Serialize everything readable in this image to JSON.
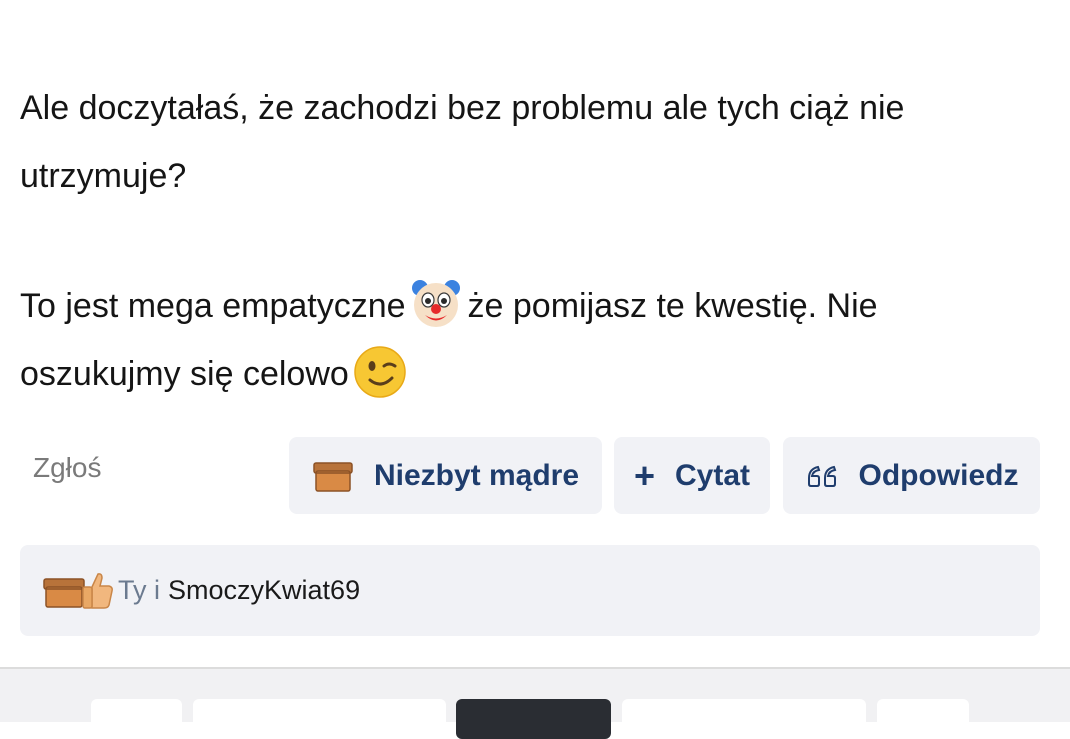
{
  "post": {
    "line1": "Ale doczytałaś, że zachodzi bez problemu ale tych ciąż nie",
    "line2": "utrzymuje?",
    "line3a": "To jest mega empatyczne",
    "line3b": "że pomijasz te kwestię. Nie",
    "line4": "oszukujmy się celowo",
    "emoji1": "clown-face",
    "emoji2": "winking-face"
  },
  "actions": {
    "report_label": "Zgłoś",
    "not_wise_label": "Niezbyt mądre",
    "quote_label": "Cytat",
    "reply_label": "Odpowiedz"
  },
  "reactions": {
    "you_label": "Ty i",
    "user_label": "SmoczyKwiat69",
    "icons": [
      "box-icon",
      "thumbs-up-icon"
    ]
  },
  "colors": {
    "accent": "#1f3d6d",
    "button_bg": "#f1f2f6",
    "muted": "#7a7a7a"
  }
}
